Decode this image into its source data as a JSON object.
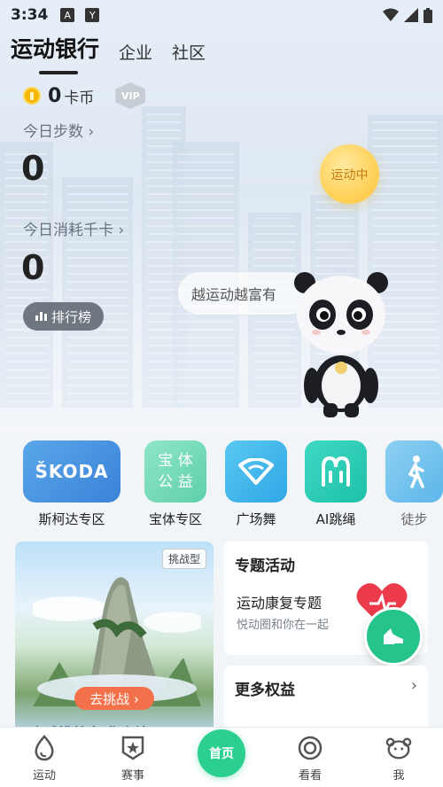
{
  "status_bar": {
    "time": "3:34"
  },
  "tabs": [
    {
      "label": "运动银行",
      "active": true
    },
    {
      "label": "企业",
      "active": false
    },
    {
      "label": "社区",
      "active": false
    }
  ],
  "coins": {
    "value": "0",
    "unit": "卡币",
    "vip": "VIP"
  },
  "steps": {
    "label": "今日步数 ›",
    "value": "0"
  },
  "calories": {
    "label": "今日消耗千卡 ›",
    "value": "0"
  },
  "rank_button": "排行榜",
  "sport_status": "运动中",
  "bubble_text": "越运动越富有",
  "shortcuts": [
    {
      "label": "斯柯达专区",
      "icon_text": "ŠKODA",
      "icon": "skoda-logo"
    },
    {
      "label": "宝体专区",
      "icon_text": "宝 体 公 益",
      "icon": "baoti-logo"
    },
    {
      "label": "广场舞",
      "icon": "fan-icon"
    },
    {
      "label": "AI跳绳",
      "icon": "jump-rope-icon"
    },
    {
      "label": "徒步",
      "icon": "walking-icon"
    }
  ],
  "challenge_card": {
    "tag": "挑战型",
    "button": "去挑战 ›",
    "title": "山岳挑战赛 华山站"
  },
  "topic_card": {
    "title": "专题活动",
    "subtitle": "运动康复专题",
    "desc": "悦动圈和你在一起"
  },
  "more_card": {
    "title": "更多权益",
    "arrow": "›"
  },
  "nav": [
    {
      "label": "运动",
      "icon": "drop-icon"
    },
    {
      "label": "赛事",
      "icon": "badge-star-icon"
    },
    {
      "label": "首页",
      "icon": "home-button"
    },
    {
      "label": "看看",
      "icon": "swirl-icon"
    },
    {
      "label": "我",
      "icon": "bear-face-icon"
    }
  ],
  "colors": {
    "accent": "#2bcf90",
    "fab": "#25c48a",
    "go_button": "#f3714a",
    "coin": "#f5b500"
  }
}
